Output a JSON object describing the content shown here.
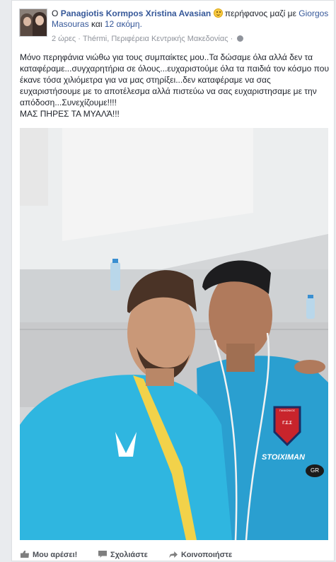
{
  "post": {
    "author": "Panagiotis Kormpos",
    "tagged": "Xristina Avasian",
    "feeling": "περήφανος μαζί με",
    "with_person": "Giorgos Masouras",
    "and_word": "και",
    "others": "12 ακόμη.",
    "prefix": "Ο",
    "time": "2 ώρες",
    "separator": "·",
    "location": "Thérmi, Περιφέρεια Κεντρικής Μακεδονίας",
    "body": "Μόνο περηφάνια νιώθω για τους συμπαίκτες μου..Τα δώσαμε όλα αλλά δεν τα καταφέραμε...συγχαρητήρια σε όλους...ευχαριστούμε όλα τα παιδιά τον κόσμο που έκανε τόσα χιλιόμετρα για να μας στηρίξει...δεν καταφέραμε να σας ευχαριστήσουμε με το αποτέλεσμα αλλά πιστεύω να σας ευχαριστησαμε με την απόδοση...Συνεχίζουμε!!!!",
    "body_line2": "ΜΑΣ ΠΗΡΕΣ ΤΑ ΜΥΑΛΆ!!!"
  },
  "photo": {
    "jersey_sponsor": "STOIXIMAN",
    "sponsor_suffix": "GR",
    "badge_text": "ΠΑΝΙΩΝΙΟΣ",
    "badge_sub": "Γ.Σ.Σ",
    "colors": {
      "jersey": "#2fb6e0",
      "wall": "#dcdcdc",
      "crest": "#c8242c"
    }
  },
  "actions": {
    "like": "Μου αρέσει!",
    "comment": "Σχολιάστε",
    "share": "Κοινοποιήστε"
  }
}
